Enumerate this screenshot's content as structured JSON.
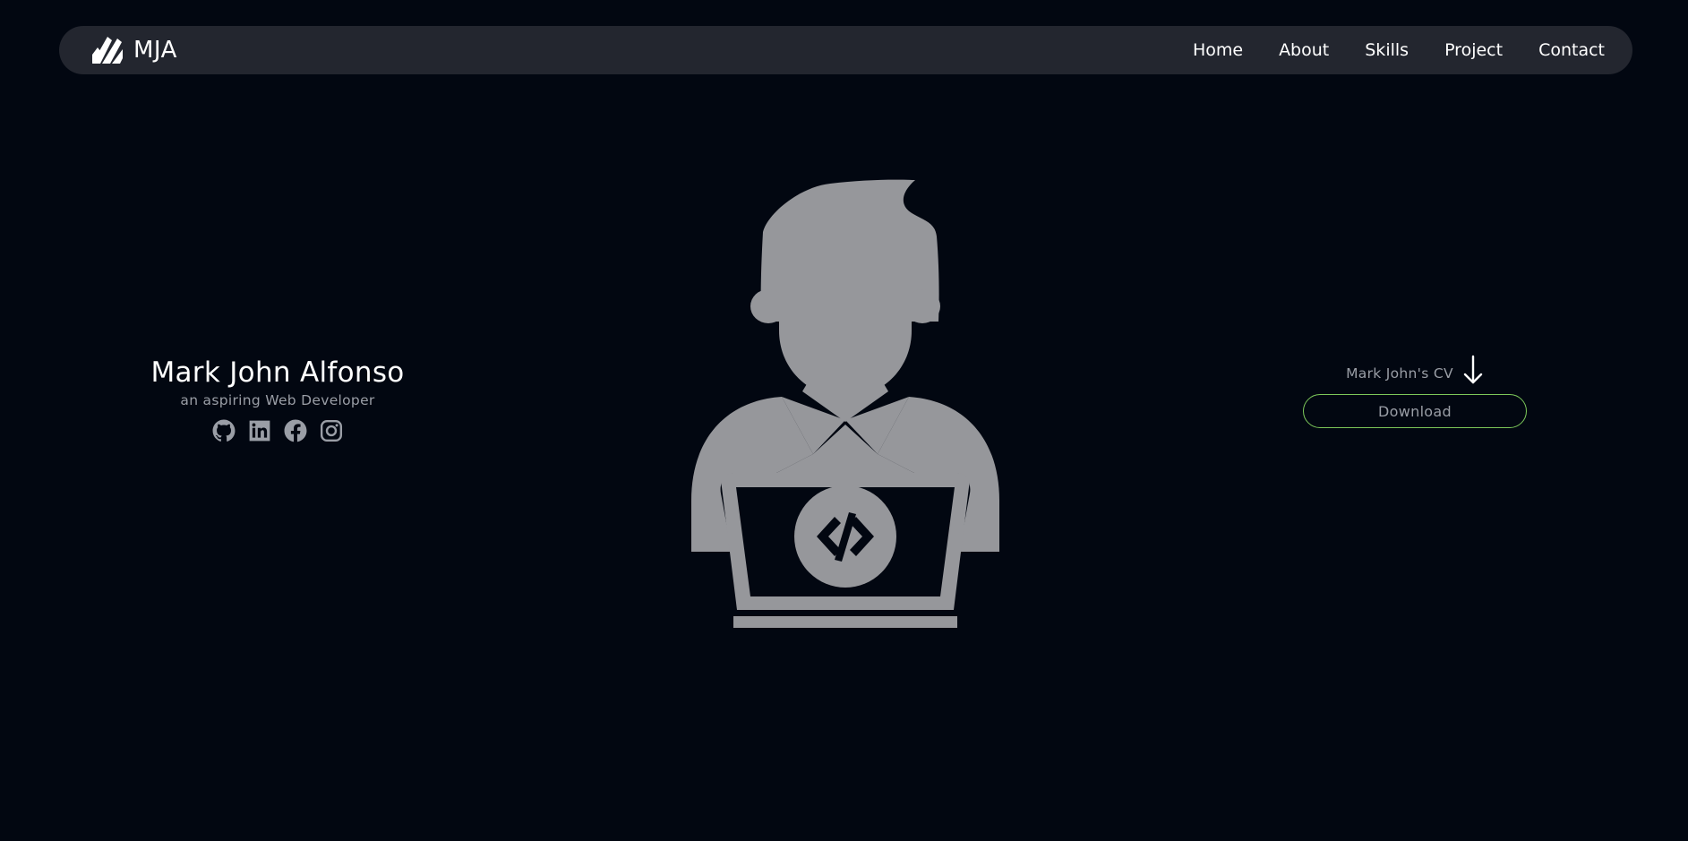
{
  "navbar": {
    "brand": "MJA",
    "logo_icon": "mja-logo-icon",
    "links": [
      {
        "label": "Home"
      },
      {
        "label": "About"
      },
      {
        "label": "Skills"
      },
      {
        "label": "Project"
      },
      {
        "label": "Contact"
      }
    ]
  },
  "intro": {
    "name": "Mark John Alfonso",
    "role": "an aspiring Web Developer",
    "socials": [
      {
        "icon": "github-icon"
      },
      {
        "icon": "linkedin-icon"
      },
      {
        "icon": "facebook-icon"
      },
      {
        "icon": "instagram-icon"
      }
    ]
  },
  "hero": {
    "illustration": "developer-avatar-icon"
  },
  "cv": {
    "label": "Mark John's CV",
    "arrow_icon": "arrow-down-icon",
    "button_label": "Download"
  },
  "colors": {
    "background": "#020711",
    "navbar": "#23262f",
    "accent": "#7cc85a",
    "muted_text": "#9a9ea6",
    "illustration": "#96979b"
  }
}
